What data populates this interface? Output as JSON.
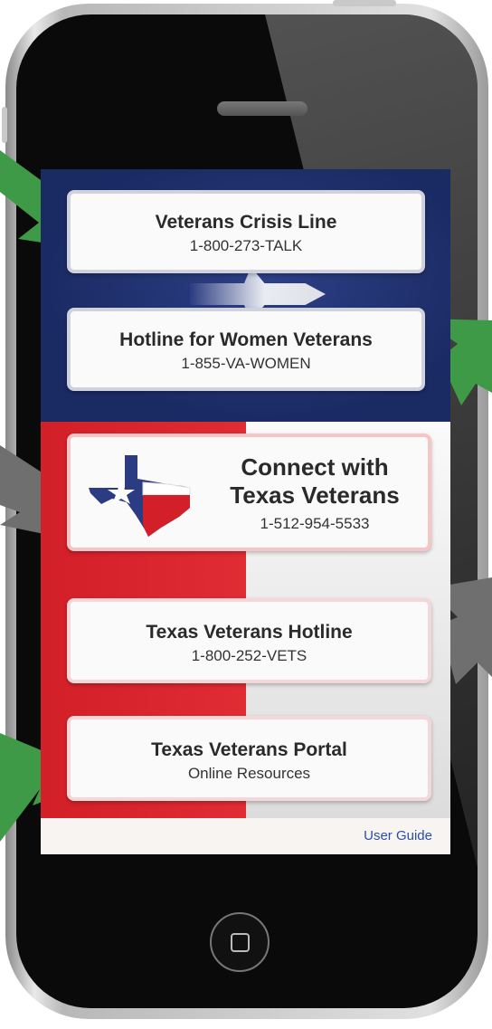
{
  "cards": [
    {
      "title": "Veterans Crisis Line",
      "subtitle": "1-800-273-TALK"
    },
    {
      "title": "Hotline for Women Veterans",
      "subtitle": "1-855-VA-WOMEN"
    },
    {
      "title": "Connect with Texas Veterans",
      "subtitle": "1-512-954-5533"
    },
    {
      "title": "Texas Veterans Hotline",
      "subtitle": "1-800-252-VETS"
    },
    {
      "title": "Texas Veterans Portal",
      "subtitle": "Online Resources"
    }
  ],
  "connect_title_line1": "Connect with",
  "connect_title_line2": "Texas Veterans",
  "footer": {
    "user_guide": "User Guide"
  },
  "colors": {
    "blue": "#1a2a63",
    "red": "#d21f28",
    "arrow_green": "#3e9a46",
    "arrow_gray": "#6f6f6f",
    "link": "#2a4ea8"
  }
}
